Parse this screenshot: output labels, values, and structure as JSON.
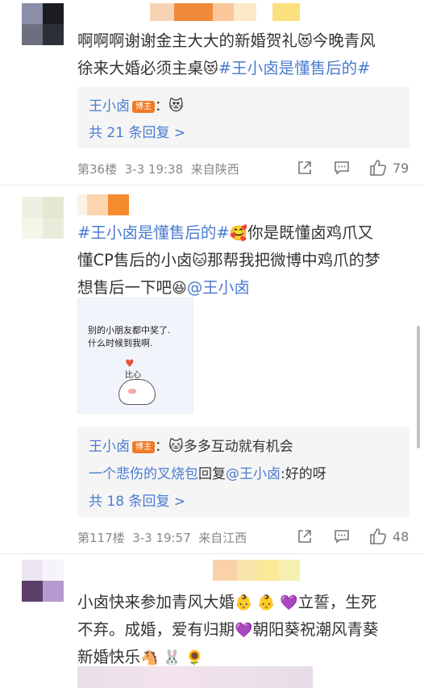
{
  "comments": [
    {
      "text": "啊啊啊谢谢金主大大的新婚贺礼",
      "emoji1": "😻",
      "text2": "今晚青风",
      "text3": "徐来大婚必须主桌",
      "emoji2": "😻",
      "topic": "#王小卤是懂售后的#",
      "reply_user": "王小卤",
      "reply_badge": "博主",
      "reply_sep": "：",
      "reply_emoji": "😻",
      "reply_more": "共 21 条回复 >",
      "floor": "第36楼",
      "date": "3-3 19:38",
      "location": "来自陕西",
      "likes": "79"
    },
    {
      "topic": "#王小卤是懂售后的#",
      "emoji1": "🥰",
      "text1": "你是既懂卤鸡爪又",
      "text2": "懂CP售后的小卤",
      "emoji2": "🐱",
      "text3": "那帮我把微博中鸡爪的梦",
      "text4": "想售后一下吧",
      "emoji3": "😆",
      "mention": "@王小卤",
      "image_line1": "别的小朋友都中奖了.",
      "image_line2": "什么时候到我啊.",
      "image_caption": "比心",
      "reply_user": "王小卤",
      "reply_badge": "博主",
      "reply_sep": "：",
      "reply_emoji": "🐱",
      "reply_text": "多多互动就有机会",
      "reply2_user": "一个悲伤的叉烧包",
      "reply2_mid": "回复",
      "reply2_mention": "@王小卤",
      "reply2_text": ":好的呀",
      "reply_more": "共 18 条回复 >",
      "floor": "第117楼",
      "date": "3-3 19:57",
      "location": "来自江西",
      "likes": "48"
    },
    {
      "text1": "小卤快来参加青风大婚",
      "emoji1": "👶 👶 💜",
      "text2": "立誓，生死",
      "text3": "不弃。成婚，爱有归期",
      "emoji2": "💜",
      "text4": "朝阳葵祝潮风青葵",
      "text5": "新婚快乐",
      "emoji3": "🐴 🐰 🌻"
    }
  ],
  "colors": {
    "link": "#4a7bd0",
    "badge": "#f07a27",
    "reply_bg": "#f5f5f5",
    "meta": "#888888"
  }
}
